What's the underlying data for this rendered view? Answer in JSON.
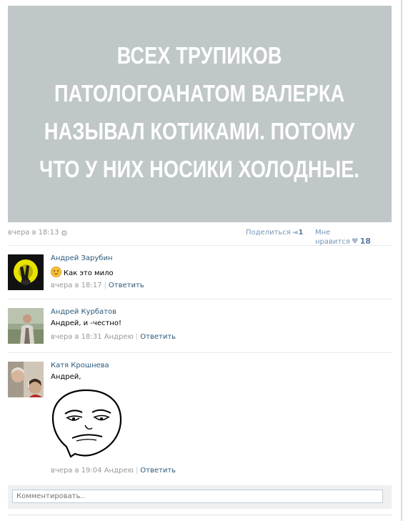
{
  "post": {
    "image_lines": [
      "ВСЕХ ТРУПИКОВ",
      "ПАТОЛОГОАНАТОМ ВАЛЕРКА",
      "НАЗЫВАЛ КОТИКАМИ. ПОТОМУ",
      "ЧТО У НИХ НОСИКИ ХОЛОДНЫЕ."
    ],
    "time": "вчера в 18:13",
    "share_label": "Поделиться",
    "share_count": "1",
    "like_label": "Мне нравится",
    "like_count": "18"
  },
  "comments": [
    {
      "author": "Андрей Зарубин",
      "text": "Как это мило",
      "time": "вчера в 18:17",
      "reply_to": "",
      "reply_label": "Ответить",
      "has_emoji": true
    },
    {
      "author": "Андрей Курбатов",
      "text": "Андрей, и -честно!",
      "time": "вчера в 18:31",
      "reply_to": "Андрею",
      "reply_label": "Ответить"
    },
    {
      "author": "Катя Крошнева",
      "text": "Андрей,",
      "time": "вчера в 19:04",
      "reply_to": "Андрею",
      "reply_label": "Ответить",
      "has_sticker": true
    }
  ],
  "comment_box": {
    "placeholder": "Комментировать.."
  },
  "icons": {
    "gear": "gear-icon",
    "share": "megaphone-icon",
    "like": "heart-icon",
    "emoji": "smile-emoji-icon"
  },
  "colors": {
    "link": "#2b587a",
    "meta": "#999999",
    "image_bg": "#c0c7c8"
  }
}
